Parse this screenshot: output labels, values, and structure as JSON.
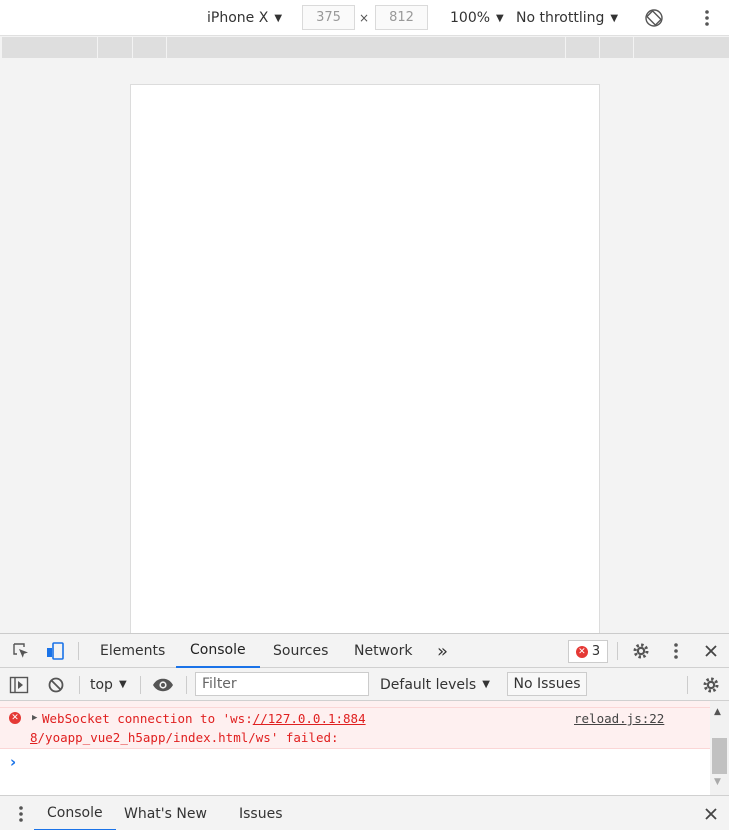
{
  "device_toolbar": {
    "device": "iPhone X",
    "width": "375",
    "height": "812",
    "dim_separator": "×",
    "zoom": "100%",
    "throttling": "No throttling"
  },
  "devtools": {
    "tabs": [
      {
        "label": "Elements"
      },
      {
        "label": "Console"
      },
      {
        "label": "Sources"
      },
      {
        "label": "Network"
      }
    ],
    "more_tabs_glyph": "»",
    "error_count": "3"
  },
  "console_toolbar": {
    "context": "top",
    "filter_placeholder": "Filter",
    "levels": "Default levels",
    "issues": "No Issues"
  },
  "console_messages": [
    {
      "level": "error",
      "text_prefix": "WebSocket connection to 'ws:",
      "link_part1": "//127.0.0.1:884",
      "link_part2": "8",
      "text_suffix": "/yoapp_vue2_h5app/index.html/ws' failed:",
      "source": "reload.js:22"
    }
  ],
  "prompt_glyph": "›",
  "drawer": {
    "tabs": [
      {
        "label": "Console"
      },
      {
        "label": "What's New"
      },
      {
        "label": "Issues"
      }
    ]
  },
  "colors": {
    "accent": "#1a73e8",
    "error": "#e53935",
    "error_bg": "#fef0f0"
  }
}
